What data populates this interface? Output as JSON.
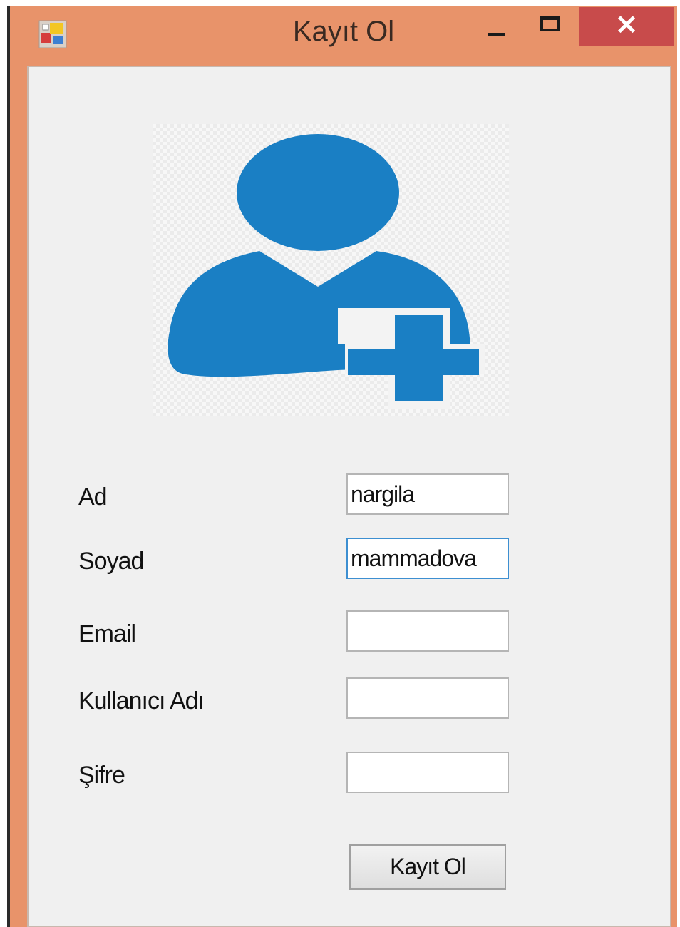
{
  "window": {
    "title": "Kayıt Ol",
    "close_glyph": "✕"
  },
  "form": {
    "fields": [
      {
        "label": "Ad",
        "value": "nargila"
      },
      {
        "label": "Soyad",
        "value": "mammadova"
      },
      {
        "label": "Email",
        "value": ""
      },
      {
        "label": "Kullanıcı Adı",
        "value": ""
      },
      {
        "label": "Şifre",
        "value": ""
      }
    ],
    "submit_label": "Kayıt Ol"
  },
  "icons": {
    "app": "app-icon",
    "avatar": "add-user-icon"
  },
  "colors": {
    "frame": "#E8936A",
    "close_button": "#C84B4B",
    "client_bg": "#F0F0F0",
    "avatar_blue": "#1A7FC4",
    "focus_border": "#3D8FD1"
  }
}
